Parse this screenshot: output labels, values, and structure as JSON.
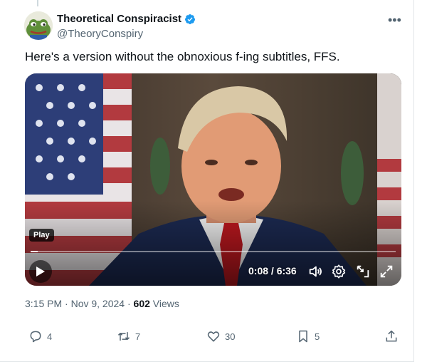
{
  "author": {
    "display_name": "Theoretical Conspiracist",
    "handle": "@TheoryConspiry",
    "verified": true
  },
  "tweet": {
    "text": "Here's a version without the obnoxious f-ing subtitles, FFS."
  },
  "video": {
    "play_label": "Play",
    "time_display": "0:08 / 6:36",
    "progress_fraction": 0.02
  },
  "meta": {
    "timestamp": "3:15 PM · Nov 9, 2024 · ",
    "views_count": "602",
    "views_label": " Views"
  },
  "actions": {
    "replies": "4",
    "reposts": "7",
    "likes": "30",
    "bookmarks": "5"
  },
  "colors": {
    "verified_badge": "#1d9bf0",
    "secondary_text": "#536471",
    "primary_text": "#0f1419"
  }
}
